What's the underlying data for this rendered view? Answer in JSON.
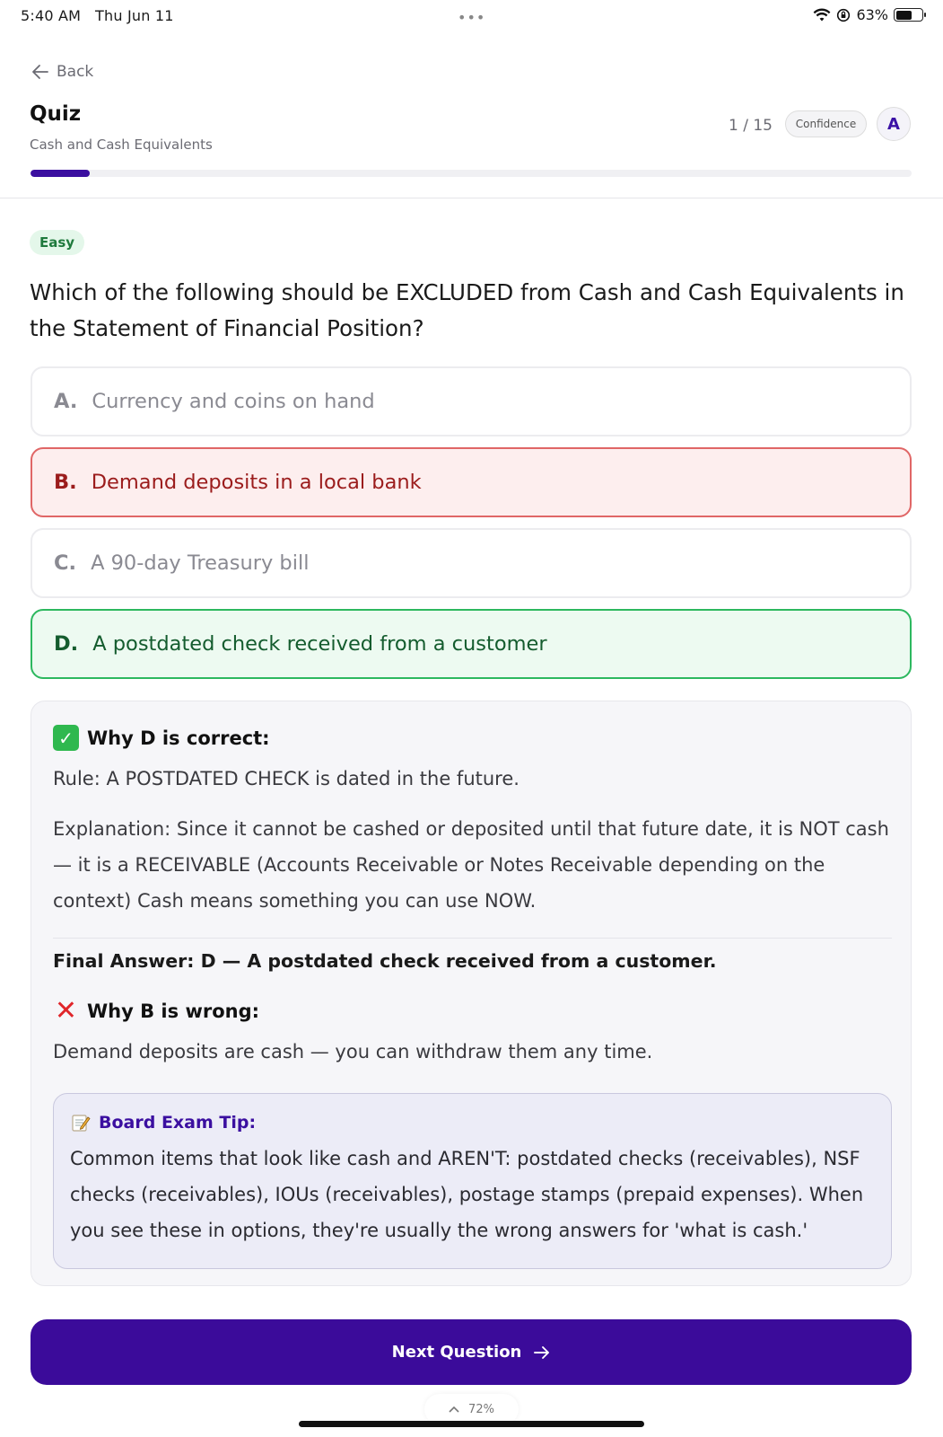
{
  "status_bar": {
    "time": "5:40 AM",
    "date": "Thu Jun 11",
    "battery": "63%",
    "battery_level": 0.63
  },
  "header": {
    "back_label": "Back",
    "title": "Quiz",
    "subtitle": "Cash and Cash Equivalents",
    "counter": "1 / 15",
    "confidence_label": "Confidence",
    "avatar_initial": "A",
    "progress_fraction": 0.067,
    "accent_color": "#3b0fa0"
  },
  "question": {
    "difficulty": "Easy",
    "text": "Which of the following should be EXCLUDED from Cash and Cash Equivalents in the Statement of Financial Position?",
    "options": [
      {
        "letter": "A.",
        "text": "Currency and coins on hand",
        "state": "neutral"
      },
      {
        "letter": "B.",
        "text": "Demand deposits in a local bank",
        "state": "selected-wrong"
      },
      {
        "letter": "C.",
        "text": "A 90-day Treasury bill",
        "state": "neutral"
      },
      {
        "letter": "D.",
        "text": "A postdated check received from a customer",
        "state": "correct"
      }
    ]
  },
  "explanation": {
    "correct_heading": "Why D is correct:",
    "rule": "Rule: A POSTDATED CHECK is dated in the future.",
    "explanation": "Explanation: Since it cannot be cashed or deposited until that future date, it is NOT cash — it is a RECEIVABLE (Accounts Receivable or Notes Receivable depending on the context) Cash means something you can use NOW.",
    "final_answer": "Final Answer: D — A postdated check received from a customer.",
    "wrong_heading": "Why B is wrong:",
    "wrong_text": "Demand deposits are cash — you can withdraw them any time.",
    "tip_heading": "Board Exam Tip:",
    "tip_text": "Common items that look like cash and AREN'T: postdated checks (receivables), NSF checks (receivables), IOUs (receivables), postage stamps (prepaid expenses). When you see these in options, they're usually the wrong answers for 'what is cash.'"
  },
  "footer": {
    "next_label": "Next Question",
    "zoom_label": "72%"
  }
}
